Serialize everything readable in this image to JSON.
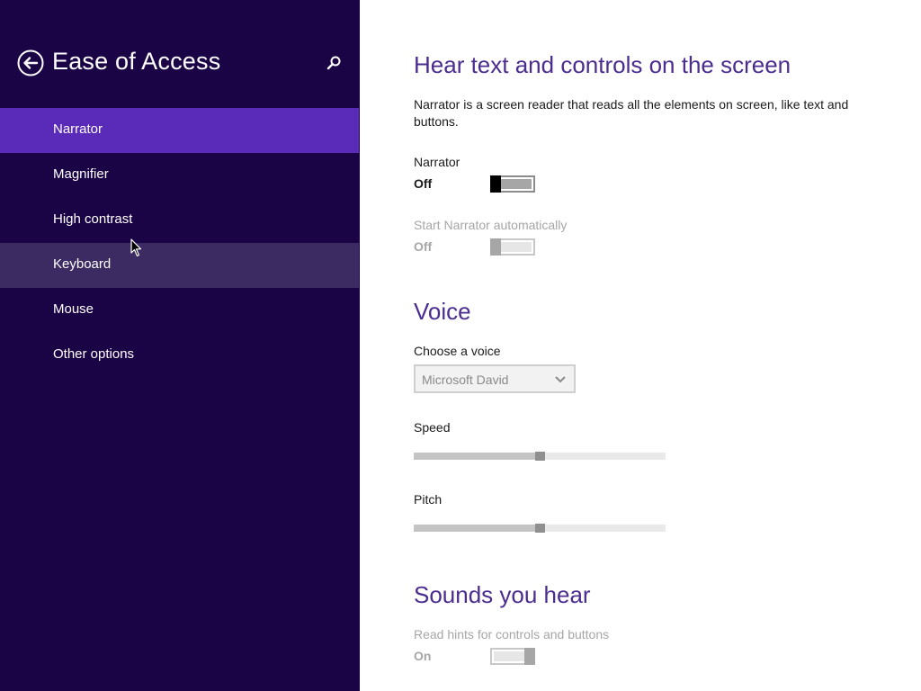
{
  "sidebar": {
    "title": "Ease of Access",
    "back_icon": "back-arrow-circle-icon",
    "search_icon": "search-icon",
    "items": [
      {
        "label": "Narrator",
        "state": "selected"
      },
      {
        "label": "Magnifier",
        "state": "normal"
      },
      {
        "label": "High contrast",
        "state": "normal"
      },
      {
        "label": "Keyboard",
        "state": "hover"
      },
      {
        "label": "Mouse",
        "state": "normal"
      },
      {
        "label": "Other options",
        "state": "normal"
      }
    ]
  },
  "main": {
    "section_hear": {
      "heading": "Hear text and controls on the screen",
      "description": "Narrator is a screen reader that reads all the elements on screen, like text and buttons.",
      "narrator": {
        "label": "Narrator",
        "state": "Off"
      },
      "start_auto": {
        "label": "Start Narrator automatically",
        "state": "Off",
        "enabled": false
      }
    },
    "section_voice": {
      "heading": "Voice",
      "choose_voice_label": "Choose a voice",
      "voice_selected": "Microsoft David",
      "speed": {
        "label": "Speed",
        "value": 0.5
      },
      "pitch": {
        "label": "Pitch",
        "value": 0.5
      }
    },
    "section_sounds": {
      "heading": "Sounds you hear",
      "read_hints": {
        "label": "Read hints for controls and buttons",
        "state": "On",
        "enabled": false
      }
    }
  },
  "colors": {
    "sidebar_bg": "#1b0446",
    "selected_bg": "#5a2ab8",
    "hover_bg": "#3c2a63",
    "heading": "#4b2d8f"
  }
}
